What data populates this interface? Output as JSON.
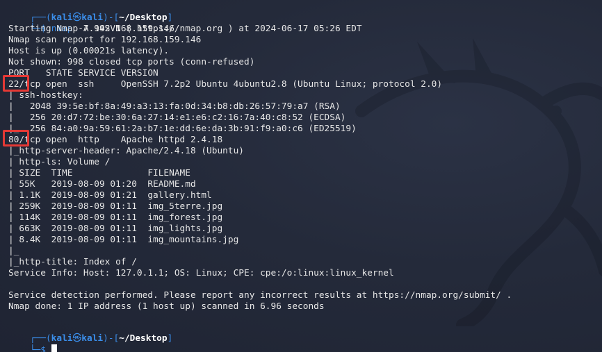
{
  "prompt": {
    "user": "kali",
    "at_symbol": "㉿",
    "host": "kali",
    "path": "~/Desktop",
    "dollar": "$"
  },
  "command": {
    "name": "nmap",
    "args": " -A 192.168.159.146"
  },
  "output": [
    "Starting Nmap 7.94SVN ( https://nmap.org ) at 2024-06-17 05:26 EDT",
    "Nmap scan report for 192.168.159.146",
    "Host is up (0.00021s latency).",
    "Not shown: 998 closed tcp ports (conn-refused)",
    "PORT   STATE SERVICE VERSION",
    "22/tcp open  ssh     OpenSSH 7.2p2 Ubuntu 4ubuntu2.8 (Ubuntu Linux; protocol 2.0)",
    "| ssh-hostkey: ",
    "|   2048 39:5e:bf:8a:49:a3:13:fa:0d:34:b8:db:26:57:79:a7 (RSA)",
    "|   256 20:d7:72:be:30:6a:27:14:e1:e6:c2:16:7a:40:c8:52 (ECDSA)",
    "|_  256 84:a0:9a:59:61:2a:b7:1e:dd:6e:da:3b:91:f9:a0:c6 (ED25519)",
    "80/tcp open  http    Apache httpd 2.4.18",
    "|_http-server-header: Apache/2.4.18 (Ubuntu)",
    "| http-ls: Volume /",
    "| SIZE  TIME              FILENAME",
    "| 55K   2019-08-09 01:20  README.md",
    "| 1.1K  2019-08-09 01:21  gallery.html",
    "| 259K  2019-08-09 01:11  img_5terre.jpg",
    "| 114K  2019-08-09 01:11  img_forest.jpg",
    "| 663K  2019-08-09 01:11  img_lights.jpg",
    "| 8.4K  2019-08-09 01:11  img_mountains.jpg",
    "|_",
    "|_http-title: Index of /",
    "Service Info: Host: 127.0.1.1; OS: Linux; CPE: cpe:/o:linux:linux_kernel",
    "",
    "Service detection performed. Please report any incorrect results at https://nmap.org/submit/ .",
    "Nmap done: 1 IP address (1 host up) scanned in 6.96 seconds"
  ],
  "highlights": [
    "22/",
    "80/"
  ],
  "colors": {
    "background": "#232939",
    "prompt_blue": "#3b8eea",
    "text": "#e6e6e6",
    "highlight_box": "#e53935"
  },
  "icons": [
    "kali-dragon-watermark",
    "cursor-block"
  ]
}
